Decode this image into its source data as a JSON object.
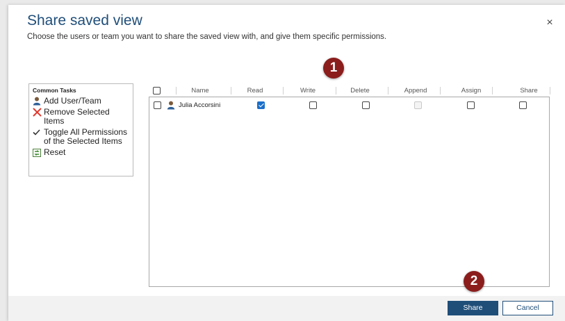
{
  "dialog": {
    "title": "Share saved view",
    "subtitle": "Choose the users or team you want to share the saved view with, and give them specific permissions.",
    "close_glyph": "×"
  },
  "tasks": {
    "title": "Common Tasks",
    "items": [
      {
        "label": "Add User/Team",
        "icon": "user-icon"
      },
      {
        "label": "Remove Selected Items",
        "icon": "red-x-icon"
      },
      {
        "label": "Toggle All Permissions of the Selected Items",
        "icon": "checkmark-icon"
      },
      {
        "label": "Reset",
        "icon": "reset-icon"
      }
    ]
  },
  "grid": {
    "columns": [
      "Name",
      "Read",
      "Write",
      "Delete",
      "Append",
      "Assign",
      "Share"
    ],
    "rows": [
      {
        "name": "Julia Accorsini",
        "permissions": {
          "Read": "checked",
          "Write": "unchecked",
          "Delete": "unchecked",
          "Append": "disabled",
          "Assign": "unchecked",
          "Share": "unchecked"
        }
      }
    ]
  },
  "callouts": [
    "1",
    "2"
  ],
  "footer": {
    "share_label": "Share",
    "cancel_label": "Cancel"
  },
  "colors": {
    "title": "#1f4e79",
    "primary_button": "#1f4e79",
    "checkbox_checked": "#1a6fc9",
    "callout_badge": "#8b1d1d",
    "remove_icon": "#e03a2f"
  }
}
